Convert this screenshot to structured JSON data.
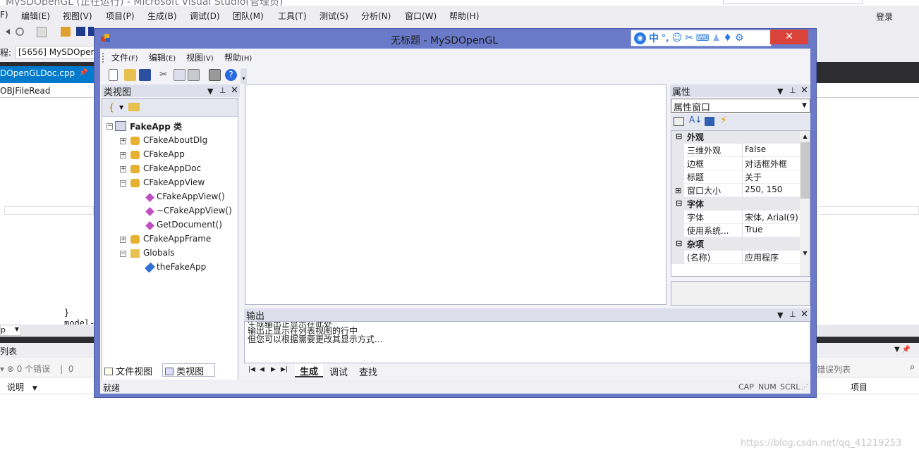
{
  "vs": {
    "title": "MySDOpenGL (正在运行) - Microsoft Visual Studio(管理员)",
    "menu_partial": "F)",
    "menus": [
      "编辑(E)",
      "视图(V)",
      "项目(P)",
      "生成(B)",
      "调试(D)",
      "团队(M)",
      "工具(T)",
      "测试(S)",
      "分析(N)",
      "窗口(W)",
      "帮助(H)"
    ],
    "login": "登录",
    "process_label": "程:",
    "process_value": "[5656] MySDOpenGL",
    "doc_tab": "DOpenGLDoc.cpp",
    "nav_text": "OBJFileRead",
    "code_lines": [
      "}",
      "model-"
    ],
    "error_list_title": "列表",
    "error_count": "0 个错误",
    "error_right": "错误列表",
    "col_desc": "说明",
    "col_project": "项目",
    "watermark": "https://blog.csdn.net/qq_41219253"
  },
  "window": {
    "title": "无标题 - MySDOpenGL",
    "close": "✕",
    "menus": [
      {
        "label": "文件",
        "key": "(F)"
      },
      {
        "label": "编辑",
        "key": "(E)"
      },
      {
        "label": "视图",
        "key": "(V)"
      },
      {
        "label": "帮助",
        "key": "(H)"
      }
    ]
  },
  "classview": {
    "title": "类视图",
    "root": "FakeApp 类",
    "items": [
      {
        "label": "CFakeAboutDlg",
        "level": 1,
        "expand": "+"
      },
      {
        "label": "CFakeApp",
        "level": 1,
        "expand": "+"
      },
      {
        "label": "CFakeAppDoc",
        "level": 1,
        "expand": "+"
      },
      {
        "label": "CFakeAppView",
        "level": 1,
        "expand": "-"
      },
      {
        "label": "CFakeAppView()",
        "level": 2,
        "expand": ""
      },
      {
        "label": "~CFakeAppView()",
        "level": 2,
        "expand": ""
      },
      {
        "label": "GetDocument()",
        "level": 2,
        "expand": ""
      },
      {
        "label": "CFakeAppFrame",
        "level": 1,
        "expand": "+"
      },
      {
        "label": "Globals",
        "level": 1,
        "expand": "-"
      },
      {
        "label": "theFakeApp",
        "level": 2,
        "expand": ""
      }
    ],
    "tab_files": "文件视图",
    "tab_classes": "类视图"
  },
  "properties": {
    "title": "属性",
    "combo": "属性窗口",
    "rows": [
      {
        "type": "cat",
        "k": "外观"
      },
      {
        "type": "row",
        "k": "三维外观",
        "v": "False"
      },
      {
        "type": "row",
        "k": "边框",
        "v": "对话框外框"
      },
      {
        "type": "row",
        "k": "标题",
        "v": "关于"
      },
      {
        "type": "row",
        "k": "窗口大小",
        "v": "250, 150",
        "expand": "+"
      },
      {
        "type": "cat",
        "k": "字体"
      },
      {
        "type": "row",
        "k": "字体",
        "v": "宋体, Arial(9)"
      },
      {
        "type": "row",
        "k": "使用系统...",
        "v": "True"
      },
      {
        "type": "cat",
        "k": "杂项"
      },
      {
        "type": "row",
        "k": "(名称)",
        "v": "应用程序"
      }
    ]
  },
  "output": {
    "title": "输出",
    "lines": [
      "生成输出正显示在此处",
      "输出正显示在列表视图的行中",
      "但您可以根据需要更改其显示方式..."
    ],
    "tabs": [
      "生成",
      "调试",
      "查找"
    ]
  },
  "status": {
    "ready": "就绪",
    "cap": "CAP",
    "num": "NUM",
    "scrl": "SCRL"
  },
  "colors": {
    "frame": "#6a79c8",
    "close": "#d9433a",
    "vs_tab": "#007acc"
  }
}
